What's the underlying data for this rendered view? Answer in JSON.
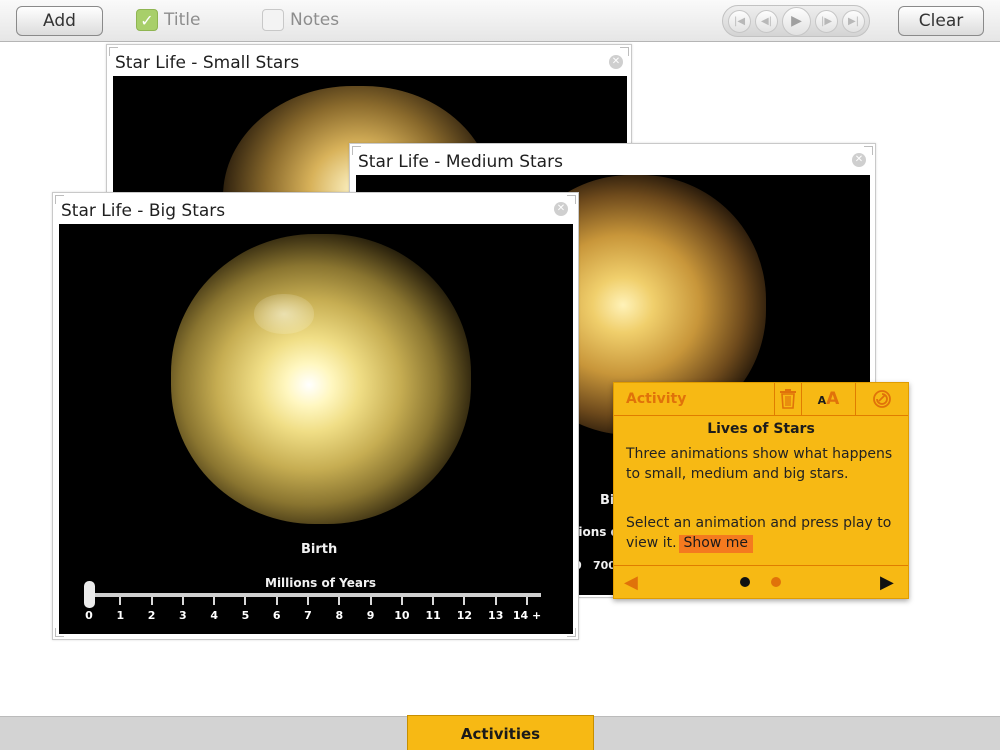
{
  "toolbar": {
    "add_label": "Add",
    "title_label": "Title",
    "title_checked": true,
    "notes_label": "Notes",
    "notes_checked": false,
    "clear_label": "Clear",
    "player_icons": [
      "skip-to-start-icon",
      "step-back-icon",
      "play-icon",
      "step-forward-icon",
      "skip-to-end-icon"
    ]
  },
  "windows": {
    "small": {
      "title": "Star Life - Small Stars"
    },
    "medium": {
      "title": "Star Life - Medium Stars",
      "visible_caption": "Bir",
      "visible_axis_fragment": "illions o",
      "visible_ticks": [
        "0",
        "700"
      ]
    },
    "big": {
      "title": "Star Life - Big Stars",
      "stage_label": "Birth",
      "axis_label": "Millions of Years",
      "ticks": [
        "0",
        "1",
        "2",
        "3",
        "4",
        "5",
        "6",
        "7",
        "8",
        "9",
        "10",
        "11",
        "12",
        "13",
        "14 +"
      ],
      "slider_position_years": 0
    }
  },
  "activity_panel": {
    "header_label": "Activity",
    "icons": [
      "trash-icon",
      "text-size-icon",
      "reset-icon"
    ],
    "text_size_glyph": "AA",
    "title": "Lives of Stars",
    "paragraph1": "Three animations show what happens to small, medium and big stars.",
    "paragraph2": "Select an animation and press play to view it.",
    "show_me_label": "Show me",
    "pages_total": 2,
    "current_page": 1
  },
  "bottom": {
    "tab_label": "Activities"
  },
  "colors": {
    "activity_panel": "#f7b914",
    "activity_accent": "#e0720a",
    "show_me_highlight": "#f47a1f",
    "title_checkbox": "#a8cf6a"
  }
}
